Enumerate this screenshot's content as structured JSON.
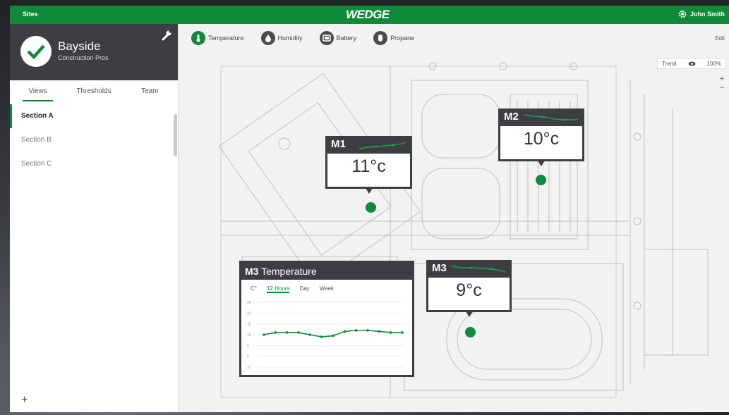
{
  "topbar": {
    "sites": "Sites",
    "logo": "WEDGE",
    "user": "John Smith"
  },
  "site": {
    "name": "Bayside",
    "subtitle": "Construction Pros"
  },
  "sidebar_tabs": [
    "Views",
    "Thresholds",
    "Team"
  ],
  "sections": [
    "Section A",
    "Section B",
    "Section C"
  ],
  "metric_tabs": [
    "Temperature",
    "Humidity",
    "Battery",
    "Propane"
  ],
  "edit_label": "Edit",
  "trend": {
    "label": "Trend",
    "zoom": "100%"
  },
  "sensors": [
    {
      "id": "M1",
      "value": "11°c"
    },
    {
      "id": "M2",
      "value": "10°c"
    },
    {
      "id": "M3",
      "value": "9°c"
    }
  ],
  "chart_panel": {
    "sensor": "M3",
    "metric": "Temperature",
    "unit": "C°",
    "ranges": [
      "12 Hours",
      "Day",
      "Week"
    ]
  },
  "chart_data": {
    "type": "line",
    "title": "M3 Temperature",
    "yticks": [
      "25",
      "20",
      "15",
      "10",
      "5",
      "0",
      "-5"
    ],
    "ylim": [
      -5,
      25
    ],
    "series": [
      {
        "values": [
          10,
          11,
          11,
          11,
          10,
          9,
          9.5,
          11.5,
          12,
          12,
          11.5,
          11,
          11
        ]
      }
    ],
    "color": "#0f8a3a"
  }
}
